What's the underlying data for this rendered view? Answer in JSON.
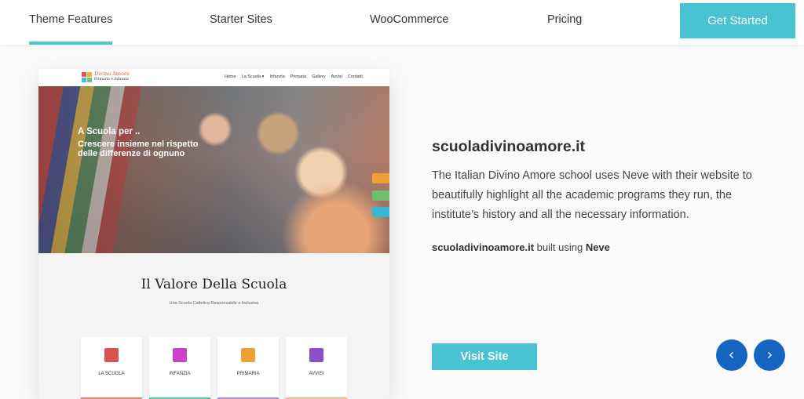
{
  "nav": {
    "items": [
      {
        "label": "Theme Features",
        "active": true
      },
      {
        "label": "Starter Sites",
        "active": false
      },
      {
        "label": "WooCommerce",
        "active": false
      },
      {
        "label": "Pricing",
        "active": false
      }
    ],
    "cta_label": "Get Started"
  },
  "preview": {
    "logo_title": "Divino Amore",
    "logo_subtitle": "Primaria e Infanzia",
    "menu": [
      "Home",
      "La Scuola ▾",
      "Infanzia",
      "Primaria",
      "Gallery",
      "Avvisi",
      "Contatti"
    ],
    "hero_title": "A Scuola per ..",
    "hero_subtitle": "Crescere insieme nel rispetto delle differenze di ognuno",
    "heading": "Il Valore Della Scuola",
    "subheading": "Una Scuola Cattolica Responsabile e Inclusiva",
    "boxes": [
      {
        "label": "LA SCUOLA",
        "color": "#d9534f"
      },
      {
        "label": "INFANZIA",
        "color": "#c845c8"
      },
      {
        "label": "PRIMARIA",
        "color": "#f0a030"
      },
      {
        "label": "AVVISI",
        "color": "#8a4fc8"
      }
    ],
    "box_bars": [
      "#e8806e",
      "#4ccaa0",
      "#b98ad6",
      "#f2b98c"
    ]
  },
  "showcase": {
    "site_name": "scuoladivinoamore.it",
    "description": "The Italian Divino Amore school uses Neve with their website to beautifully highlight all the academic programs they run, the institute’s history and all the necessary information.",
    "built_site": "scuoladivinoamore.it",
    "built_text": " built using ",
    "built_theme": "Neve",
    "visit_label": "Visit Site"
  },
  "colors": {
    "accent": "#49c3d3",
    "arrow": "#1565c0"
  },
  "icons": {
    "prev": "chevron-left-icon",
    "next": "chevron-right-icon"
  }
}
